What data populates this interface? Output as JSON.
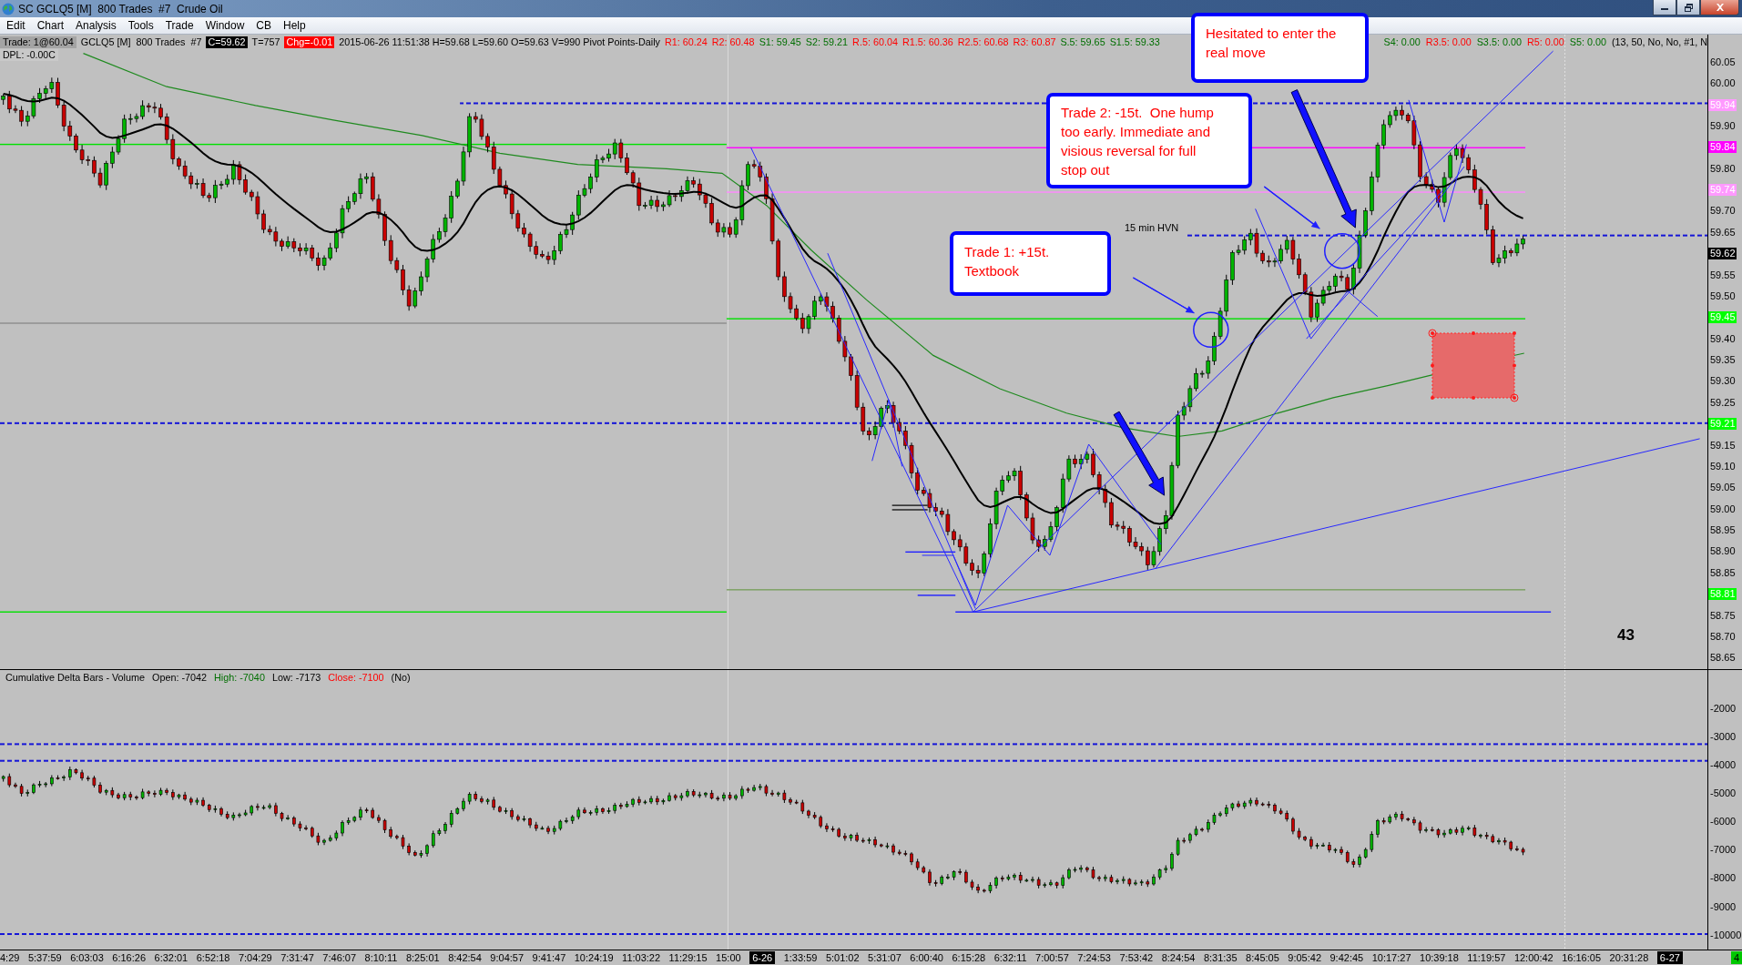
{
  "window": {
    "title": "SC GCLQ5 [M]  800 Trades  #7  Crude Oil"
  },
  "menu": [
    "Edit",
    "Chart",
    "Analysis",
    "Tools",
    "Trade",
    "Window",
    "CB",
    "Help"
  ],
  "price_chart": {
    "info_line": [
      [
        {
          "kind": "trade",
          "text": "Trade: 1@60.04"
        },
        {
          "kind": "text",
          "text": "GCLQ5 [M]  800 Trades  #7"
        },
        {
          "kind": "last",
          "text": "C=59.62"
        },
        {
          "kind": "text",
          "text": "T=757"
        },
        {
          "kind": "change",
          "text": "Chg=-0.01"
        },
        {
          "kind": "text",
          "text": "2015-06-26 11:51:38 H=59.68 L=59.60 O=59.63 V=990 Pivot Points-Daily"
        },
        {
          "kind": "resistance",
          "text": "R1: 60.24"
        },
        {
          "kind": "resistance",
          "text": "R2: 60.48"
        },
        {
          "kind": "support",
          "text": "S1: 59.45"
        },
        {
          "kind": "support",
          "text": "S2: 59.21"
        },
        {
          "kind": "resistance",
          "text": "R.5: 60.04"
        },
        {
          "kind": "resistance",
          "text": "R1.5: 60.36"
        },
        {
          "kind": "resistance",
          "text": "R2.5: 60.68"
        },
        {
          "kind": "resistance",
          "text": "R3: 60.87"
        },
        {
          "kind": "support",
          "text": "S.5: 59.65"
        },
        {
          "kind": "support",
          "text": "S1.5: 59.33"
        }
      ],
      [
        {
          "kind": "support",
          "text": "S4: 0.00"
        },
        {
          "kind": "resistance",
          "text": "R3.5: 0.00"
        },
        {
          "kind": "support",
          "text": "S3.5: 0.00"
        },
        {
          "kind": "resistance",
          "text": "R5: 0.00"
        },
        {
          "kind": "support",
          "text": "S5: 0.00"
        },
        {
          "kind": "text",
          "text": "(13, 50, No, No, #1, N"
        }
      ]
    ],
    "dpl": "DPL: -0.00C",
    "hvn_label": "15 min HVN",
    "bar_counter": "43",
    "notes": [
      "Hesitated to enter the real move",
      "Trade 2: -15t.  One hump too early. Immediate and visious reversal for full stop out",
      "Trade 1: +15t. Textbook"
    ],
    "axis_labels": [
      {
        "kind": "tick",
        "text": "60.05"
      },
      {
        "kind": "tick",
        "text": "60.00"
      },
      {
        "kind": "marker",
        "text": "59.94",
        "color": "#ff99ff"
      },
      {
        "kind": "tick",
        "text": "59.90"
      },
      {
        "kind": "marker",
        "text": "59.84",
        "color": "#ff00ff"
      },
      {
        "kind": "tick",
        "text": "59.80"
      },
      {
        "kind": "marker",
        "text": "59.74",
        "color": "#ff99ff"
      },
      {
        "kind": "tick",
        "text": "59.70"
      },
      {
        "kind": "tick",
        "text": "59.65"
      },
      {
        "kind": "marker",
        "text": "59.62",
        "color": "#000000"
      },
      {
        "kind": "tick",
        "text": "59.55"
      },
      {
        "kind": "tick",
        "text": "59.50"
      },
      {
        "kind": "marker",
        "text": "59.45",
        "color": "#00ff00"
      },
      {
        "kind": "tick",
        "text": "59.40"
      },
      {
        "kind": "tick",
        "text": "59.35"
      },
      {
        "kind": "tick",
        "text": "59.30"
      },
      {
        "kind": "tick",
        "text": "59.25"
      },
      {
        "kind": "marker",
        "text": "59.21",
        "color": "#00ff00"
      },
      {
        "kind": "tick",
        "text": "59.15"
      },
      {
        "kind": "tick",
        "text": "59.10"
      },
      {
        "kind": "tick",
        "text": "59.05"
      },
      {
        "kind": "tick",
        "text": "59.00"
      },
      {
        "kind": "tick",
        "text": "58.95"
      },
      {
        "kind": "tick",
        "text": "58.90"
      },
      {
        "kind": "tick",
        "text": "58.85"
      },
      {
        "kind": "marker",
        "text": "58.81",
        "color": "#00ff00"
      },
      {
        "kind": "tick",
        "text": "58.75"
      },
      {
        "kind": "tick",
        "text": "58.70"
      },
      {
        "kind": "tick",
        "text": "58.65"
      }
    ]
  },
  "delta_chart": {
    "header": [
      {
        "kind": "plain",
        "text": "Cumulative Delta Bars - Volume"
      },
      {
        "kind": "plain",
        "text": "Open: -7042"
      },
      {
        "kind": "up",
        "text": "High: -7040"
      },
      {
        "kind": "plain",
        "text": "Low: -7173"
      },
      {
        "kind": "down",
        "text": "Close: -7100"
      },
      {
        "kind": "plain",
        "text": "(No)"
      }
    ],
    "axis_labels": [
      "-2000",
      "-3000",
      "-4000",
      "-5000",
      "-6000",
      "-7000",
      "-8000",
      "-9000",
      "-10000"
    ]
  },
  "time_axis": {
    "labels": [
      {
        "kind": "time",
        "text": "4:29"
      },
      {
        "kind": "time",
        "text": "5:37:59"
      },
      {
        "kind": "time",
        "text": "6:03:03"
      },
      {
        "kind": "time",
        "text": "6:16:26"
      },
      {
        "kind": "time",
        "text": "6:32:01"
      },
      {
        "kind": "time",
        "text": "6:52:18"
      },
      {
        "kind": "time",
        "text": "7:04:29"
      },
      {
        "kind": "time",
        "text": "7:31:47"
      },
      {
        "kind": "time",
        "text": "7:46:07"
      },
      {
        "kind": "time",
        "text": "8:10:11"
      },
      {
        "kind": "time",
        "text": "8:25:01"
      },
      {
        "kind": "time",
        "text": "8:42:54"
      },
      {
        "kind": "time",
        "text": "9:04:57"
      },
      {
        "kind": "time",
        "text": "9:41:47"
      },
      {
        "kind": "time",
        "text": "10:24:19"
      },
      {
        "kind": "time",
        "text": "11:03:22"
      },
      {
        "kind": "time",
        "text": "11:29:15"
      },
      {
        "kind": "time",
        "text": "15:00"
      },
      {
        "kind": "date",
        "text": "6-26"
      },
      {
        "kind": "time",
        "text": "1:33:59"
      },
      {
        "kind": "time",
        "text": "5:01:02"
      },
      {
        "kind": "time",
        "text": "5:31:07"
      },
      {
        "kind": "time",
        "text": "6:00:40"
      },
      {
        "kind": "time",
        "text": "6:15:28"
      },
      {
        "kind": "time",
        "text": "6:32:11"
      },
      {
        "kind": "time",
        "text": "7:00:57"
      },
      {
        "kind": "time",
        "text": "7:24:53"
      },
      {
        "kind": "time",
        "text": "7:53:42"
      },
      {
        "kind": "time",
        "text": "8:24:54"
      },
      {
        "kind": "time",
        "text": "8:31:35"
      },
      {
        "kind": "time",
        "text": "8:45:05"
      },
      {
        "kind": "time",
        "text": "9:05:42"
      },
      {
        "kind": "time",
        "text": "9:42:45"
      },
      {
        "kind": "time",
        "text": "10:17:27"
      },
      {
        "kind": "time",
        "text": "10:39:18"
      },
      {
        "kind": "time",
        "text": "11:19:57"
      },
      {
        "kind": "time",
        "text": "12:00:42"
      },
      {
        "kind": "time",
        "text": "16:16:05"
      },
      {
        "kind": "time",
        "text": "20:31:28"
      },
      {
        "kind": "date",
        "text": "6-27"
      }
    ],
    "bar_badge": "4"
  }
}
